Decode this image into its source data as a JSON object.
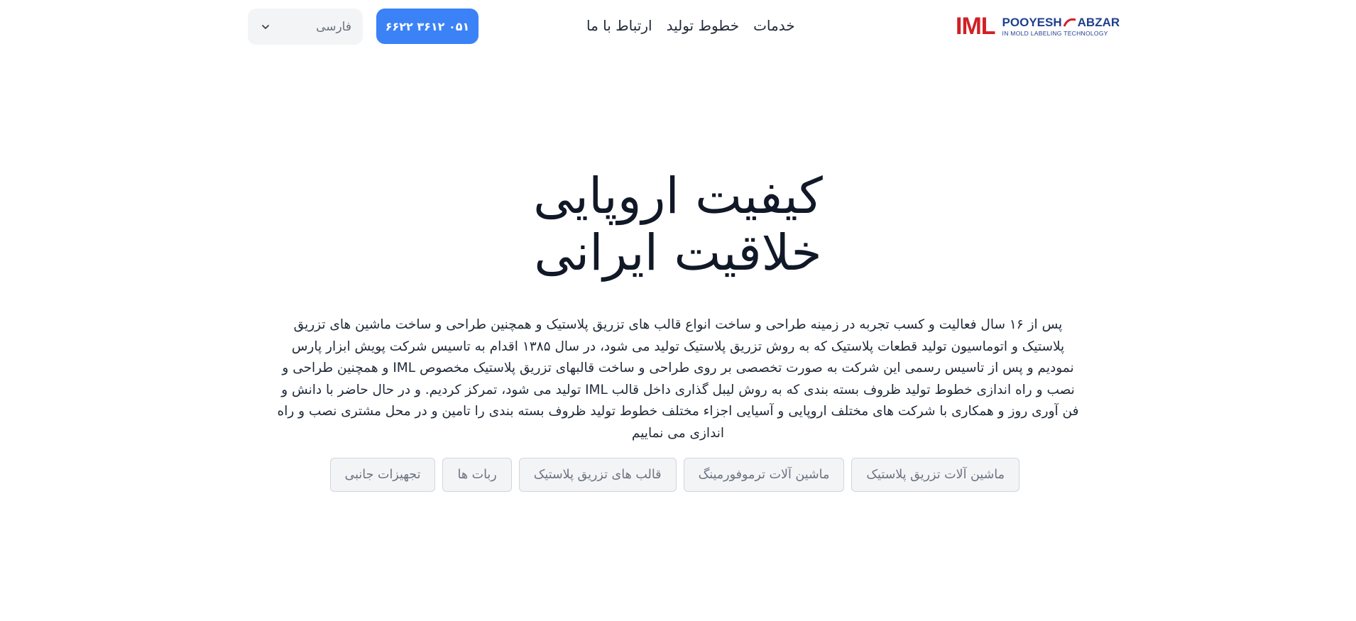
{
  "header": {
    "logo": {
      "iml": "IML",
      "brand_left": "POOYESH",
      "brand_right": "ABZAR",
      "tagline": "IN MOLD LABELING TECHNOLOGY"
    },
    "nav": [
      {
        "label": "خدمات"
      },
      {
        "label": "خطوط تولید"
      },
      {
        "label": "ارتباط با ما"
      }
    ],
    "phone_button": "۰۵۱ ۳۶۱۲ ۶۶۲۲",
    "language_select": {
      "value": "فارسی"
    }
  },
  "hero": {
    "title_line1": "کیفیت اروپایی",
    "title_line2": "خلاقیت ایرانی",
    "description": "پس از ۱۶ سال فعالیت و کسب تجربه در زمینه طراحی و ساخت انواع قالب های تزریق پلاستیک و همچنین طراحی و ساخت ماشین های تزریق پلاستیک و اتوماسیون تولید قطعات پلاستیک که به روش تزریق پلاستیک تولید می شود، در سال ۱۳۸۵ اقدام به تاسیس شرکت پویش ابزار پارس نمودیم و پس از تاسیس رسمی این شرکت به صورت تخصصی بر روی طراحی و ساخت قالبهای تزریق پلاستیک مخصوص IML و همچنین طراحی و نصب و راه اندازی خطوط تولید ظروف بسته بندی که به روش لیبل گذاری داخل قالب IML تولید می شود، تمرکز کردیم. و در حال حاضر با دانش و فن آوری روز و همکاری با شرکت های مختلف اروپایی و آسیایی اجزاء مختلف خطوط تولید ظروف بسته بندی را تامین و در محل مشتری نصب و راه اندازی می نماییم"
  },
  "categories": [
    {
      "label": "ماشین آلات تزریق پلاستیک"
    },
    {
      "label": "ماشین آلات ترموفورمینگ"
    },
    {
      "label": "قالب های تزریق پلاستیک"
    },
    {
      "label": "ربات ها"
    },
    {
      "label": "تجهیزات جانبی"
    }
  ],
  "colors": {
    "accent": "#3b82f6",
    "logo_red": "#d21f26",
    "logo_blue": "#1f3f8f",
    "chip_bg": "#f3f4f6"
  },
  "icons": {
    "language_chevron": "chevron-down-icon"
  }
}
